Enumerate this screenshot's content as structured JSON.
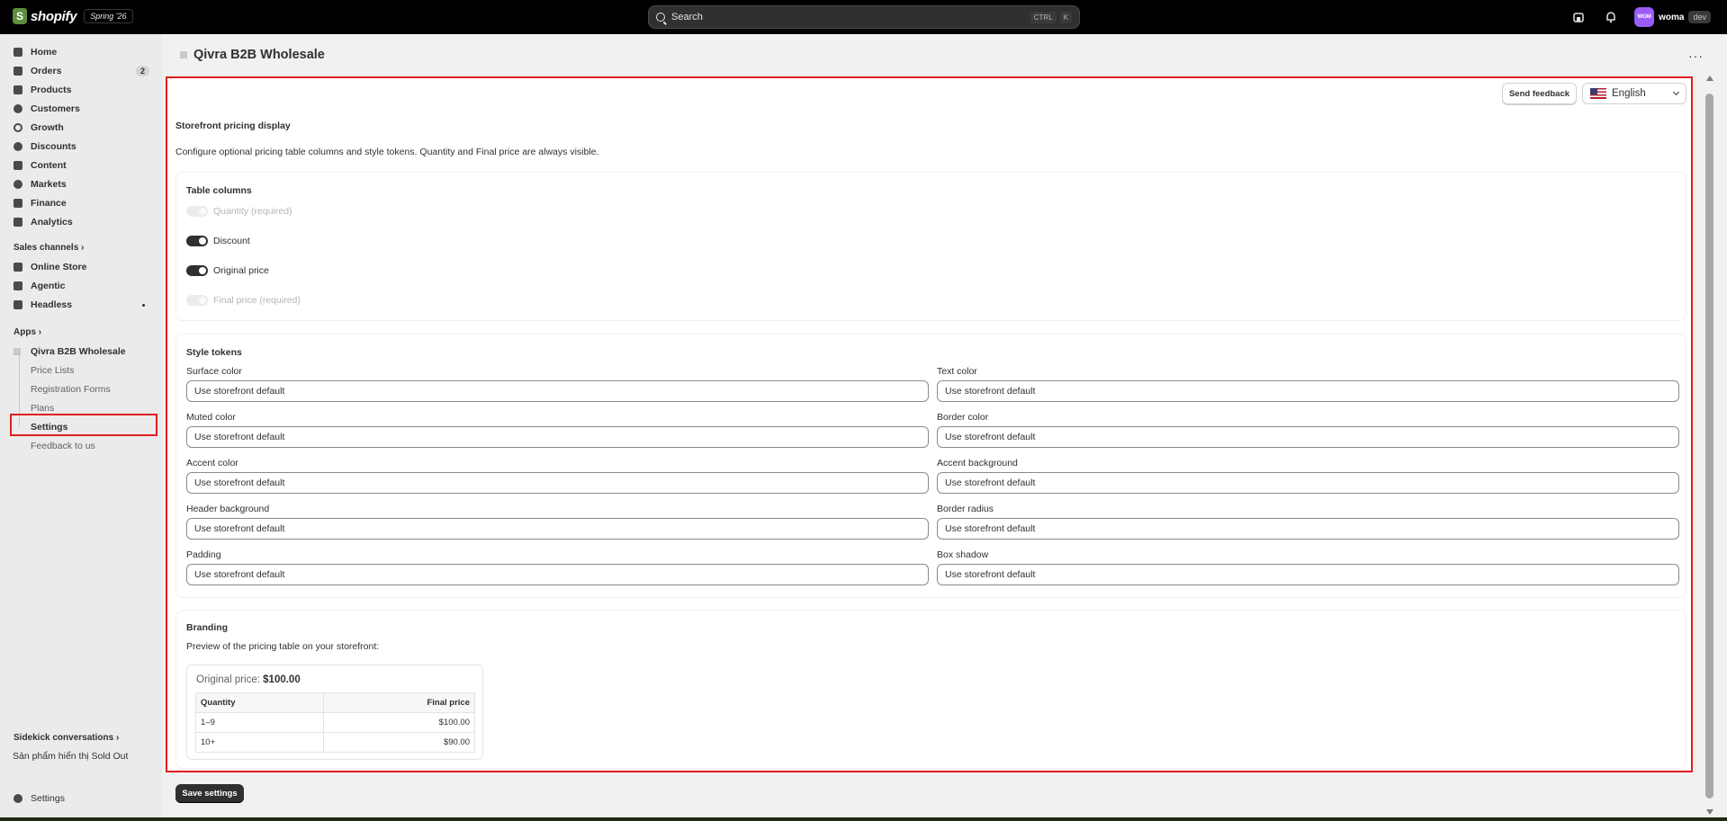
{
  "topbar": {
    "brand": "shopify",
    "edition": "Spring '26",
    "search_placeholder": "Search",
    "shortcut_ctrl": "CTRL",
    "shortcut_key": "K",
    "account_initials": "WOM",
    "account_name": "woma",
    "account_badge": "dev"
  },
  "sidebar": {
    "items": [
      {
        "label": "Home",
        "icon": "home-icon"
      },
      {
        "label": "Orders",
        "icon": "orders-icon",
        "badge": "2"
      },
      {
        "label": "Products",
        "icon": "tag-icon"
      },
      {
        "label": "Customers",
        "icon": "person-icon"
      },
      {
        "label": "Growth",
        "icon": "growth-icon"
      },
      {
        "label": "Discounts",
        "icon": "discount-icon"
      },
      {
        "label": "Content",
        "icon": "content-icon"
      },
      {
        "label": "Markets",
        "icon": "globe-icon"
      },
      {
        "label": "Finance",
        "icon": "bank-icon"
      },
      {
        "label": "Analytics",
        "icon": "bar-chart-icon"
      }
    ],
    "sales_channels_header": "Sales channels",
    "channels": [
      {
        "label": "Online Store",
        "icon": "store-icon"
      },
      {
        "label": "Agentic",
        "icon": "agent-icon"
      },
      {
        "label": "Headless",
        "icon": "headless-icon"
      }
    ],
    "apps_header": "Apps",
    "app_name": "Qivra B2B Wholesale",
    "app_subitems": [
      "Price Lists",
      "Registration Forms",
      "Plans",
      "Settings",
      "Feedback to us"
    ],
    "sidekick_header": "Sidekick conversations",
    "sidekick_item": "Sản phẩm hiển thị Sold Out",
    "settings_label": "Settings"
  },
  "page": {
    "title": "Qivra B2B Wholesale",
    "more_label": "···"
  },
  "content": {
    "feedback_button": "Send feedback",
    "language": "English",
    "heading": "Storefront pricing display",
    "description": "Configure optional pricing table columns and style tokens. Quantity and Final price are always visible.",
    "table_columns": {
      "title": "Table columns",
      "toggles": [
        {
          "label": "Quantity (required)",
          "on": false,
          "disabled": true
        },
        {
          "label": "Discount",
          "on": true,
          "disabled": false
        },
        {
          "label": "Original price",
          "on": true,
          "disabled": false
        },
        {
          "label": "Final price (required)",
          "on": false,
          "disabled": true
        }
      ]
    },
    "style_tokens": {
      "title": "Style tokens",
      "placeholder": "Use storefront default",
      "fields": [
        "Surface color",
        "Text color",
        "Muted color",
        "Border color",
        "Accent color",
        "Accent background",
        "Header background",
        "Border radius",
        "Padding",
        "Box shadow"
      ]
    },
    "branding": {
      "title": "Branding",
      "preview_caption": "Preview of the pricing table on your storefront:",
      "original_price_label": "Original price:",
      "original_price_value": "$100.00",
      "table_headers": [
        "Quantity",
        "Final price"
      ],
      "rows": [
        {
          "quantity": "1–9",
          "price": "$100.00"
        },
        {
          "quantity": "10+",
          "price": "$90.00"
        }
      ]
    },
    "save_button": "Save settings"
  }
}
